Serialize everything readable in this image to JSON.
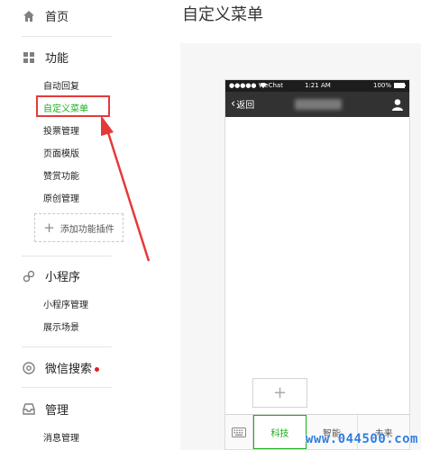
{
  "sidebar": {
    "home_label": "首页",
    "function_label": "功能",
    "function_items": [
      "自动回复",
      "自定义菜单",
      "投票管理",
      "页面模版",
      "赞赏功能",
      "原创管理"
    ],
    "add_plugin_label": "添加功能插件",
    "miniprogram_label": "小程序",
    "miniprogram_items": [
      "小程序管理",
      "展示场景"
    ],
    "wechat_search_label": "微信搜索",
    "manage_label": "管理",
    "manage_items": [
      "消息管理"
    ]
  },
  "main": {
    "page_title": "自定义菜单"
  },
  "phone": {
    "carrier": "●●●●● WeChat",
    "time": "1:21 AM",
    "battery": "100%",
    "back_label": "返回",
    "add_symbol": "+",
    "menu_tabs": [
      "科技",
      "智能",
      "未来"
    ]
  },
  "watermark": "www.044500.com",
  "colors": {
    "accent_green": "#1aad19",
    "annotation_red": "#e43a3a",
    "watermark_blue": "#2f7de1"
  }
}
